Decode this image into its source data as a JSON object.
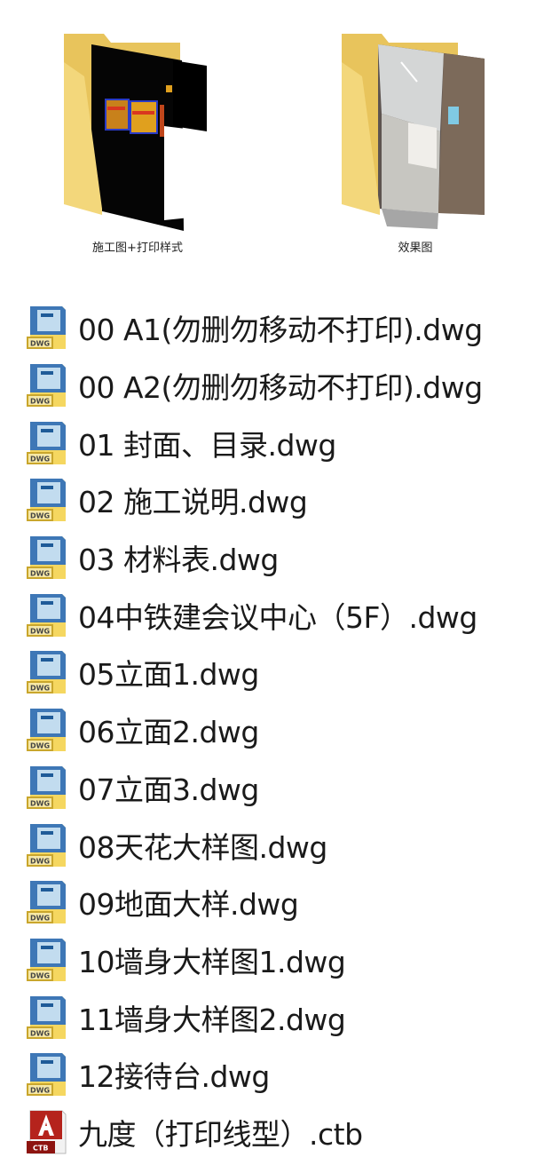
{
  "folders": [
    {
      "name": "施工图+打印样式",
      "icon": "folder-with-cad-preview-icon"
    },
    {
      "name": "效果图",
      "icon": "folder-with-rendering-preview-icon"
    }
  ],
  "files": [
    {
      "name": "00 A1(勿删勿移动不打印).dwg",
      "icon": "dwg-file-icon"
    },
    {
      "name": "00 A2(勿删勿移动不打印).dwg",
      "icon": "dwg-file-icon"
    },
    {
      "name": "01 封面、目录.dwg",
      "icon": "dwg-file-icon"
    },
    {
      "name": "02 施工说明.dwg",
      "icon": "dwg-file-icon"
    },
    {
      "name": "03 材料表.dwg",
      "icon": "dwg-file-icon"
    },
    {
      "name": "04中铁建会议中心（5F）.dwg",
      "icon": "dwg-file-icon"
    },
    {
      "name": "05立面1.dwg",
      "icon": "dwg-file-icon"
    },
    {
      "name": "06立面2.dwg",
      "icon": "dwg-file-icon"
    },
    {
      "name": "07立面3.dwg",
      "icon": "dwg-file-icon"
    },
    {
      "name": "08天花大样图.dwg",
      "icon": "dwg-file-icon"
    },
    {
      "name": "09地面大样.dwg",
      "icon": "dwg-file-icon"
    },
    {
      "name": "10墙身大样图1.dwg",
      "icon": "dwg-file-icon"
    },
    {
      "name": "11墙身大样图2.dwg",
      "icon": "dwg-file-icon"
    },
    {
      "name": "12接待台.dwg",
      "icon": "dwg-file-icon"
    },
    {
      "name": "九度（打印线型）.ctb",
      "icon": "ctb-file-icon"
    }
  ]
}
